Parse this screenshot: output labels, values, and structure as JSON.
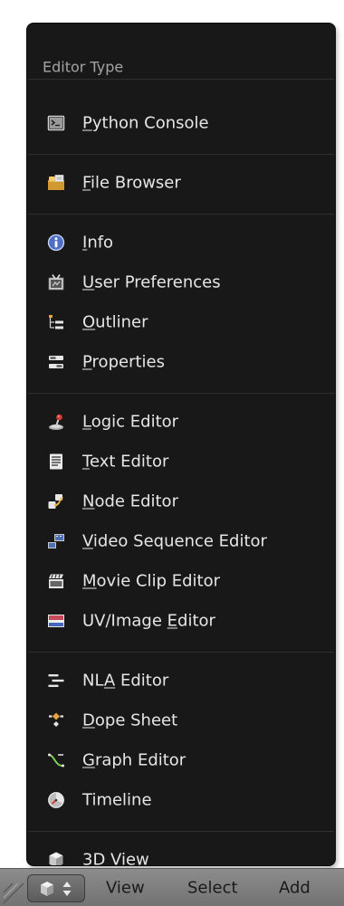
{
  "menu": {
    "title": "Editor Type",
    "groups": [
      [
        {
          "mnemonic": "P",
          "rest": "ython Console",
          "icon": "python-console-icon"
        }
      ],
      [
        {
          "mnemonic": "F",
          "rest": "ile Browser",
          "icon": "file-browser-icon"
        }
      ],
      [
        {
          "mnemonic": "I",
          "rest": "nfo",
          "icon": "info-icon"
        },
        {
          "mnemonic": "U",
          "rest": "ser Preferences",
          "icon": "user-preferences-icon"
        },
        {
          "mnemonic": "O",
          "rest": "utliner",
          "icon": "outliner-icon"
        },
        {
          "mnemonic": "P",
          "rest": "roperties",
          "icon": "properties-icon"
        }
      ],
      [
        {
          "mnemonic": "L",
          "rest": "ogic Editor",
          "icon": "logic-editor-icon"
        },
        {
          "mnemonic": "T",
          "rest": "ext Editor",
          "icon": "text-editor-icon"
        },
        {
          "mnemonic": "N",
          "rest": "ode Editor",
          "icon": "node-editor-icon"
        },
        {
          "mnemonic": "V",
          "rest": "ideo Sequence Editor",
          "icon": "video-sequence-editor-icon"
        },
        {
          "mnemonic": "M",
          "rest": "ovie Clip Editor",
          "icon": "movie-clip-editor-icon"
        },
        {
          "before": "UV/Image ",
          "mnemonic": "E",
          "rest": "ditor",
          "icon": "uv-image-editor-icon"
        }
      ],
      [
        {
          "before": "NL",
          "mnemonic": "A",
          "rest": " Editor",
          "icon": "nla-editor-icon"
        },
        {
          "mnemonic": "D",
          "rest": "ope Sheet",
          "icon": "dope-sheet-icon"
        },
        {
          "mnemonic": "G",
          "rest": "raph Editor",
          "icon": "graph-editor-icon"
        },
        {
          "before": "Timeline",
          "icon": "timeline-icon"
        }
      ],
      [
        {
          "before": "3D Vie",
          "mnemonic": "w",
          "rest": "",
          "icon": "3d-view-icon"
        }
      ]
    ]
  },
  "header": {
    "editor_button_icon": "3d-view-icon",
    "menus": [
      "View",
      "Select",
      "Add"
    ]
  },
  "colors": {
    "menu_bg": "#181818",
    "menu_text": "#e6e6e6",
    "menu_title": "#a4a4a4",
    "header_bg": "#808080"
  }
}
